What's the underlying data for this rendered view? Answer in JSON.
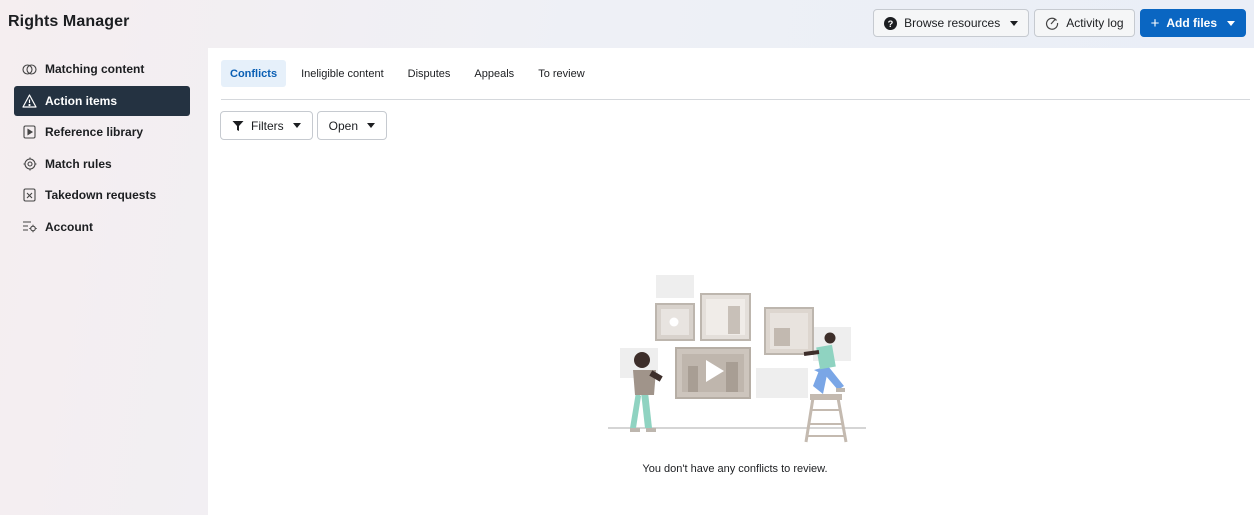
{
  "app": {
    "title": "Rights Manager"
  },
  "top_actions": {
    "browse_label": "Browse resources",
    "activity_label": "Activity log",
    "add_label": "Add files"
  },
  "sidebar": {
    "items": [
      {
        "label": "Matching content",
        "icon": "matching-content-icon"
      },
      {
        "label": "Action items",
        "icon": "warning-triangle-icon",
        "active": true
      },
      {
        "label": "Reference library",
        "icon": "reference-library-icon"
      },
      {
        "label": "Match rules",
        "icon": "match-rules-icon"
      },
      {
        "label": "Takedown requests",
        "icon": "takedown-icon"
      },
      {
        "label": "Account",
        "icon": "account-settings-icon"
      }
    ]
  },
  "main": {
    "tabs": [
      {
        "label": "Conflicts",
        "active": true
      },
      {
        "label": "Ineligible content"
      },
      {
        "label": "Disputes"
      },
      {
        "label": "Appeals"
      },
      {
        "label": "To review"
      }
    ],
    "filters": {
      "filters_label": "Filters",
      "status_label": "Open"
    },
    "empty_message": "You don't have any conflicts to review."
  },
  "colors": {
    "primary": "#0a66c2",
    "active_nav": "#243241",
    "active_tab_bg": "#e6f0fa"
  }
}
